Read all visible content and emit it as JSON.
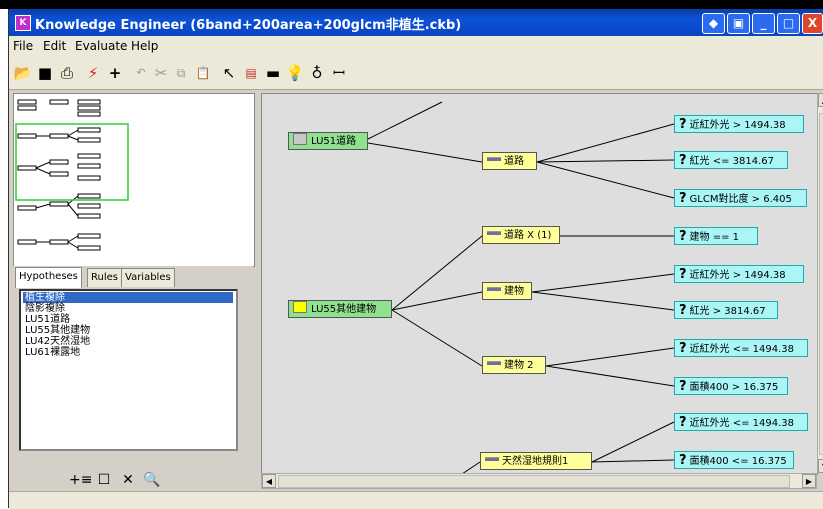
{
  "window": {
    "title": "Knowledge Engineer (6band+200area+200glcm非植生.ckb)",
    "controls": [
      "◆",
      "▣",
      "_",
      "□",
      "X"
    ]
  },
  "menu": {
    "file": "File",
    "edit": "Edit",
    "evaluate": "Evaluate",
    "help": "Help"
  },
  "toolbar_icons": [
    "open-icon",
    "save-icon",
    "print-icon",
    "lightning-icon",
    "crosshair-icon",
    "undo-icon",
    "cut-icon",
    "copy-icon",
    "paste-icon",
    "pointer-icon",
    "rule-icon",
    "minus-icon",
    "bulb-icon",
    "bulb-alt-icon",
    "variable-icon"
  ],
  "tabs": {
    "hypotheses": "Hypotheses",
    "rules": "Rules",
    "variables": "Variables"
  },
  "hypotheses": [
    "植生複除",
    "陰影複除",
    "LU51道路",
    "LU55其他建物",
    "LU42天然湿地",
    "LU61裸露地"
  ],
  "tree": {
    "hyp_lu51": "LU51道路",
    "hyp_lu55": "LU55其他建物",
    "rule_road": "道路",
    "rule_road_x": "道路 X (1)",
    "rule_building": "建物",
    "rule_building2": "建物 2",
    "rule_wetland": "天然湿地規則1",
    "cond1": "近紅外光 > 1494.38",
    "cond2": "紅光 <= 3814.67",
    "cond3": "GLCM對比度 > 6.405",
    "cond4": "建物 == 1",
    "cond5": "近紅外光 > 1494.38",
    "cond6": "紅光 > 3814.67",
    "cond7": "近紅外光 <= 1494.38",
    "cond8": "面積400 > 16.375",
    "cond9": "近紅外光 <= 1494.38",
    "cond10": "面積400 <= 16.375"
  },
  "colors": {
    "hypothesis": "#8fe08f",
    "rule": "#ffff99",
    "condition": "#aaf5f5",
    "title_bar": "#0b52d8"
  }
}
